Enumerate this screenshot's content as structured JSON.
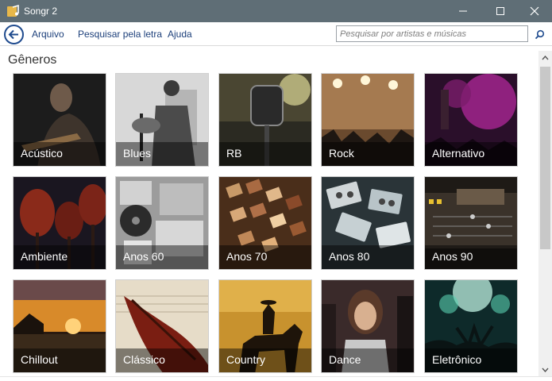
{
  "window": {
    "title": "Songr 2",
    "icon": "music-note-icon"
  },
  "menu": {
    "items": [
      "Arquivo",
      "Pesquisar pela letra",
      "Ajuda"
    ],
    "back_icon": "arrow-left-icon",
    "search_placeholder": "Pesquisar por artistas e músicas",
    "search_value": "",
    "search_icon": "search-icon"
  },
  "content": {
    "section_title": "Gêneros",
    "genres": [
      "Acústico",
      "Blues",
      "RB",
      "Rock",
      "Alternativo",
      "Ambiente",
      "Anos 60",
      "Anos 70",
      "Anos 80",
      "Anos 90",
      "Chillout",
      "Clássico",
      "Country",
      "Dance",
      "Eletrônico"
    ]
  },
  "colors": {
    "titlebar": "#5f6e76",
    "accent": "#1c3f7a"
  }
}
